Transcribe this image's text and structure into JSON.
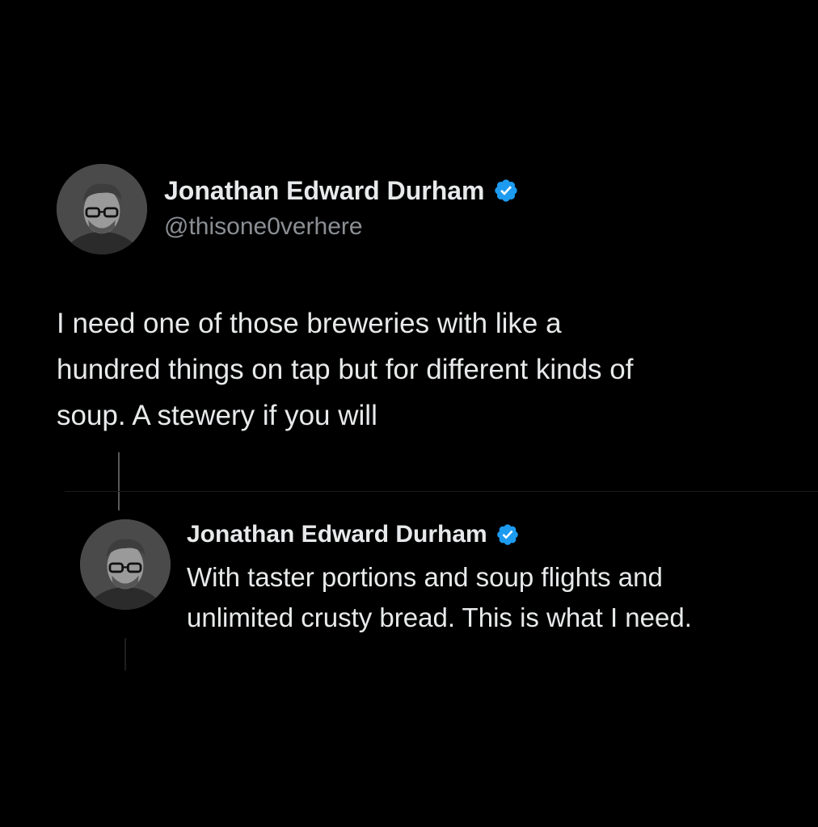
{
  "main_tweet": {
    "author_name": "Jonathan Edward Durham",
    "handle": "@thisone0verhere",
    "text": "I need one of those breweries with like a\nhundred things on tap but for different kinds of\nsoup. A stewery if you will"
  },
  "reply_tweet": {
    "author_name": "Jonathan Edward Durham",
    "text": "With taster portions and soup flights and\nunlimited crusty bread. This is what I need."
  },
  "colors": {
    "background": "#000000",
    "primary_text": "#e7e9ea",
    "secondary_text": "#8b8f94",
    "verified_badge": "#1d9bf0"
  },
  "icons": {
    "verified": "verified-badge-icon",
    "avatar": "profile-avatar"
  }
}
